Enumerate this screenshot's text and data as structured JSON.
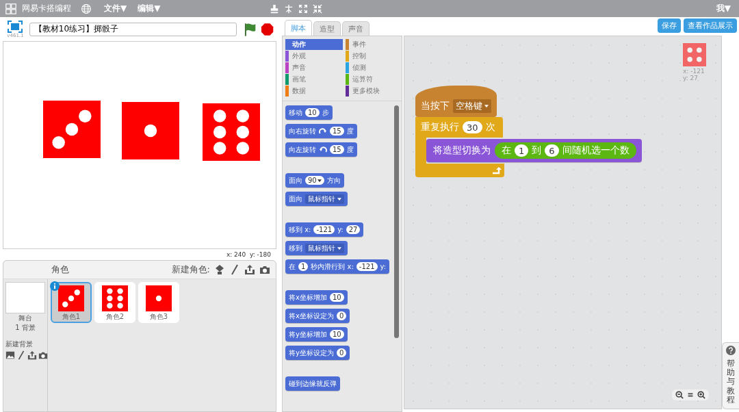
{
  "topbar": {
    "brand": "网易卡搭编程",
    "menus": [
      {
        "label": "文件▼"
      },
      {
        "label": "编辑▼"
      }
    ],
    "user": "我▼"
  },
  "stage": {
    "version": "v461.1",
    "title": "【教材10练习】掷骰子",
    "coords": "x: 240  y: -180",
    "sprites": [
      {
        "kind": "three"
      },
      {
        "kind": "one"
      },
      {
        "kind": "six"
      }
    ]
  },
  "sprites_panel": {
    "title": "角色",
    "new_label": "新建角色:",
    "stage_label": "舞台",
    "backdrops": "1 背景",
    "new_backdrop": "新建背景",
    "items": [
      {
        "name": "角色1",
        "kind": "three",
        "selected": true
      },
      {
        "name": "角色2",
        "kind": "six",
        "selected": false
      },
      {
        "name": "角色3",
        "kind": "one",
        "selected": false
      }
    ]
  },
  "tabs": [
    {
      "label": "脚本",
      "selected": true
    },
    {
      "label": "造型",
      "selected": false
    },
    {
      "label": "声音",
      "selected": false
    }
  ],
  "categories": [
    {
      "label": "动作",
      "color": "#4a6cd4",
      "selected": true
    },
    {
      "label": "事件",
      "color": "#c88330",
      "selected": false
    },
    {
      "label": "外观",
      "color": "#8a55d7",
      "selected": false
    },
    {
      "label": "控制",
      "color": "#e1a91a",
      "selected": false
    },
    {
      "label": "声音",
      "color": "#bb42c3",
      "selected": false
    },
    {
      "label": "侦测",
      "color": "#2ca5e2",
      "selected": false
    },
    {
      "label": "画笔",
      "color": "#0e9a6c",
      "selected": false
    },
    {
      "label": "运算符",
      "color": "#5cb712",
      "selected": false
    },
    {
      "label": "数据",
      "color": "#ee7d16",
      "selected": false
    },
    {
      "label": "更多模块",
      "color": "#632d99",
      "selected": false
    }
  ],
  "palette_groups": [
    {
      "blocks": [
        {
          "kind": "motion",
          "parts": [
            {
              "kind": "text",
              "text": "移动"
            },
            {
              "kind": "num",
              "text": "10"
            },
            {
              "kind": "text",
              "text": "步"
            }
          ]
        },
        {
          "kind": "motion",
          "parts": [
            {
              "kind": "text",
              "text": "向右旋转"
            },
            {
              "kind": "turnright"
            },
            {
              "kind": "num",
              "text": "15"
            },
            {
              "kind": "text",
              "text": "度"
            }
          ]
        },
        {
          "kind": "motion",
          "parts": [
            {
              "kind": "text",
              "text": "向左旋转"
            },
            {
              "kind": "turnleft"
            },
            {
              "kind": "num",
              "text": "15"
            },
            {
              "kind": "text",
              "text": "度"
            }
          ]
        }
      ]
    },
    {
      "blocks": [
        {
          "kind": "motion",
          "parts": [
            {
              "kind": "text",
              "text": "面向"
            },
            {
              "kind": "numdrop",
              "text": "90"
            },
            {
              "kind": "text",
              "text": "方向"
            }
          ]
        },
        {
          "kind": "motion",
          "parts": [
            {
              "kind": "text",
              "text": "面向"
            },
            {
              "kind": "drop",
              "text": "鼠标指针"
            }
          ]
        }
      ]
    },
    {
      "blocks": [
        {
          "kind": "motion",
          "parts": [
            {
              "kind": "text",
              "text": "移到 x:"
            },
            {
              "kind": "num",
              "text": "-121"
            },
            {
              "kind": "text",
              "text": "y:"
            },
            {
              "kind": "num",
              "text": "27"
            }
          ]
        },
        {
          "kind": "motion",
          "parts": [
            {
              "kind": "text",
              "text": "移到"
            },
            {
              "kind": "drop",
              "text": "鼠标指针"
            }
          ]
        },
        {
          "kind": "motion",
          "parts": [
            {
              "kind": "text",
              "text": "在"
            },
            {
              "kind": "num",
              "text": "1"
            },
            {
              "kind": "text",
              "text": "秒内滑行到 x:"
            },
            {
              "kind": "num",
              "text": "-121"
            },
            {
              "kind": "text",
              "text": "y:"
            }
          ]
        }
      ]
    },
    {
      "blocks": [
        {
          "kind": "motion",
          "parts": [
            {
              "kind": "text",
              "text": "将x坐标增加"
            },
            {
              "kind": "num",
              "text": "10"
            }
          ]
        },
        {
          "kind": "motion",
          "parts": [
            {
              "kind": "text",
              "text": "将x坐标设定为"
            },
            {
              "kind": "num",
              "text": "0"
            }
          ]
        },
        {
          "kind": "motion",
          "parts": [
            {
              "kind": "text",
              "text": "将y坐标增加"
            },
            {
              "kind": "num",
              "text": "10"
            }
          ]
        },
        {
          "kind": "motion",
          "parts": [
            {
              "kind": "text",
              "text": "将y坐标设定为"
            },
            {
              "kind": "num",
              "text": "0"
            }
          ]
        }
      ]
    },
    {
      "blocks": [
        {
          "kind": "motion",
          "parts": [
            {
              "kind": "text",
              "text": "碰到边缘就反弹"
            }
          ]
        }
      ]
    }
  ],
  "buttons": [
    {
      "label": "保存"
    },
    {
      "label": "查看作品展示"
    }
  ],
  "scripts": {
    "sprite_info": {
      "kind": "four",
      "x": "x: -121",
      "y": "y: 27"
    },
    "hat": {
      "kind": "events",
      "parts": [
        {
          "kind": "text",
          "text": "当按下"
        },
        {
          "kind": "drop",
          "text": "空格键"
        }
      ]
    },
    "repeat": {
      "kind": "control",
      "parts": [
        {
          "kind": "text",
          "text": "重复执行"
        },
        {
          "kind": "num",
          "text": "30"
        },
        {
          "kind": "text",
          "text": "次"
        }
      ],
      "inner": [
        {
          "kind": "looks",
          "parts": [
            {
              "kind": "text",
              "text": "将造型切换为"
            },
            {
              "kind": "operators",
              "parts": [
                {
                  "kind": "text",
                  "text": "在"
                },
                {
                  "kind": "num",
                  "text": "1"
                },
                {
                  "kind": "text",
                  "text": "到"
                },
                {
                  "kind": "num",
                  "text": "6"
                },
                {
                  "kind": "text",
                  "text": "间随机选一个数"
                }
              ]
            }
          ]
        }
      ]
    }
  },
  "help": {
    "label": "帮助与教程"
  }
}
